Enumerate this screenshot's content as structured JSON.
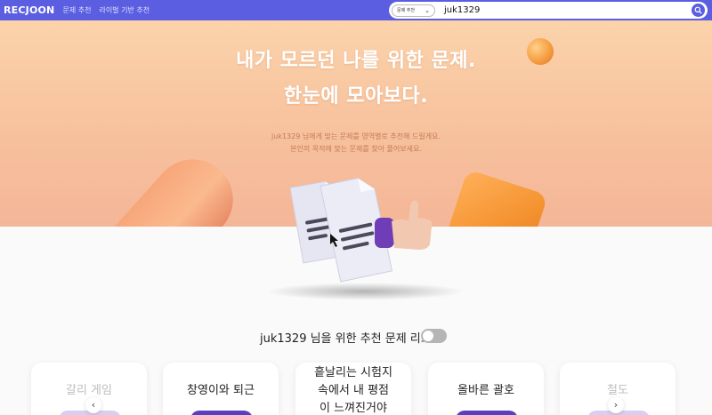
{
  "nav": {
    "logo": "RECJOON",
    "links": [
      "문제 추천",
      "라이벌 기반 추천"
    ],
    "search": {
      "select_label": "문제 추천",
      "value": "juk1329"
    }
  },
  "hero": {
    "title_line1": "내가 모르던 나를 위한 문제.",
    "title_line2": "한눈에 모아보다.",
    "subtitle_line1": "juk1329 님에게 맞는 문제를 영역별로 추천해 드릴게요.",
    "subtitle_line2": "본인의 목적에 맞는 문제를 찾아 풀어보세요."
  },
  "list": {
    "heading": "juk1329 님을 위한 추천 문제 리스트",
    "toggle_on": false
  },
  "cards": [
    {
      "title": "갈리 게임"
    },
    {
      "title": "창영이와 퇴근"
    },
    {
      "title": "흩날리는 시험지 속에서 내 평점이 느껴진거야"
    },
    {
      "title": "올바른 괄호"
    },
    {
      "title": "철도"
    }
  ],
  "colors": {
    "accent": "#5b5ee0",
    "button": "#5b3fc0"
  },
  "icons": [
    "search-icon",
    "chevron-down-icon",
    "chevron-left-icon",
    "chevron-right-icon"
  ]
}
